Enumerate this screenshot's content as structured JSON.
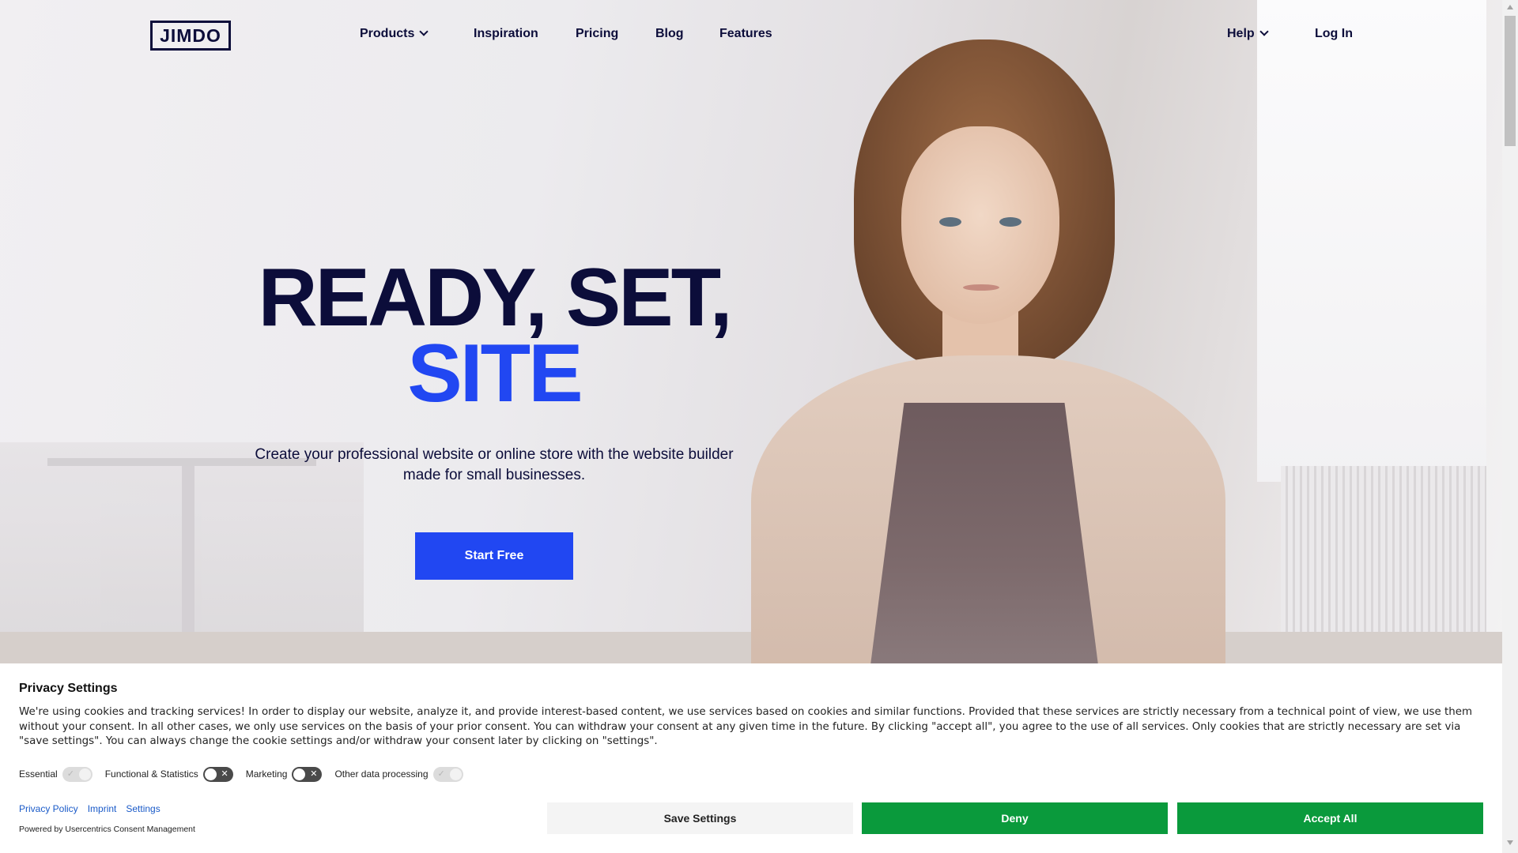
{
  "brand": {
    "logo_text": "JIMDO",
    "primary_color": "#2147f2",
    "navy": "#0c0d3a",
    "consent_green": "#0a9a3c"
  },
  "nav": {
    "items": [
      {
        "label": "Products",
        "has_dropdown": true
      },
      {
        "label": "Inspiration",
        "has_dropdown": false
      },
      {
        "label": "Pricing",
        "has_dropdown": false
      },
      {
        "label": "Blog",
        "has_dropdown": false
      },
      {
        "label": "Features",
        "has_dropdown": false
      }
    ],
    "help_label": "Help",
    "login_label": "Log In"
  },
  "hero": {
    "headline_line1": "READY, SET,",
    "headline_line2": "SITE",
    "subtitle": "Create your professional website or online store with the website builder made for small businesses.",
    "cta_label": "Start Free"
  },
  "consent": {
    "title": "Privacy Settings",
    "text": "We're using cookies and tracking services! In order to display our website, analyze it, and provide interest-based content, we use services based on cookies and similar functions. Provided that these services are strictly necessary from a technical point of view, we use them without your consent. In all other cases, we only use services on the basis of your prior consent. You can withdraw your consent at any given time in the future. By clicking \"accept all\", you agree to the use of all services. Only cookies that are strictly necessary are set via \"save settings\". You can always change the cookie settings and/or withdraw your consent later by clicking on \"settings\".",
    "toggles": [
      {
        "label": "Essential",
        "state": "on-disabled"
      },
      {
        "label": "Functional & Statistics",
        "state": "off"
      },
      {
        "label": "Marketing",
        "state": "off"
      },
      {
        "label": "Other data processing",
        "state": "on-disabled"
      }
    ],
    "links": [
      "Privacy Policy",
      "Imprint",
      "Settings"
    ],
    "powered_by": "Powered by Usercentrics Consent Management",
    "buttons": {
      "save": "Save Settings",
      "deny": "Deny",
      "accept": "Accept All"
    }
  }
}
